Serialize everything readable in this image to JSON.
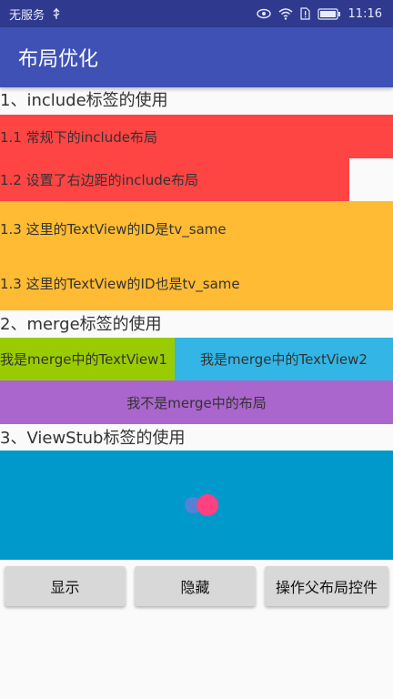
{
  "status_bar": {
    "carrier": "无服务",
    "time": "11:16",
    "icons": [
      "usb-icon",
      "eye-icon",
      "wifi-icon",
      "sim-alert-icon",
      "battery-icon"
    ]
  },
  "app_bar": {
    "title": "布局优化"
  },
  "sections": {
    "include": {
      "title": "1、include标签的使用",
      "item1": "1.1 常规下的include布局",
      "item2": "1.2 设置了右边距的include布局",
      "item3": "1.3 这里的TextView的ID是tv_same",
      "item4": "1.3 这里的TextView的ID也是tv_same"
    },
    "merge": {
      "title": "2、merge标签的使用",
      "left": "我是merge中的TextView1",
      "right": "我是merge中的TextView2",
      "bottom": "我不是merge中的布局"
    },
    "viewstub": {
      "title": "3、ViewStub标签的使用"
    }
  },
  "buttons": {
    "show": "显示",
    "hide": "隐藏",
    "operate_parent": "操作父布局控件"
  },
  "colors": {
    "status_bar": "#2f3a8f",
    "app_bar": "#3f51b5",
    "red": "#ff4444",
    "orange": "#ffbb33",
    "green": "#99cc00",
    "sky": "#33b5e5",
    "purple": "#aa66cc",
    "blue": "#0099cc",
    "accent": "#ff4081"
  }
}
